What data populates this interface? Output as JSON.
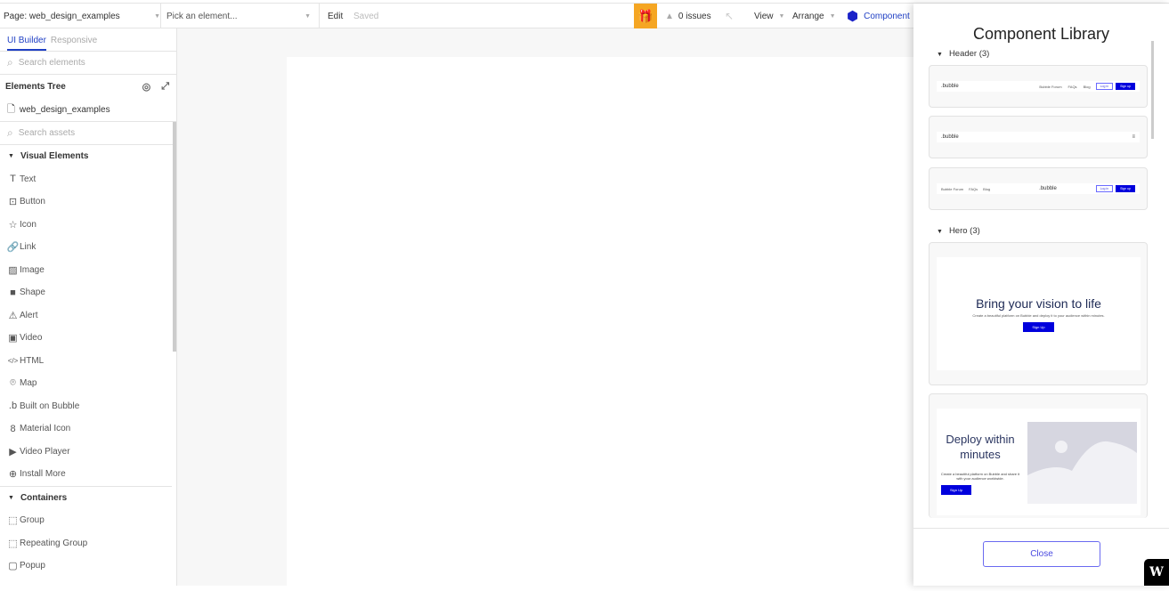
{
  "topbar": {
    "page_label": "Page: web_design_examples",
    "element_placeholder": "Pick an element...",
    "edit": "Edit",
    "saved": "Saved",
    "issues": "0 issues",
    "view": "View",
    "arrange": "Arrange",
    "components": "Component"
  },
  "left": {
    "tabs": [
      "UI Builder",
      "Responsive"
    ],
    "search_elements": "Search elements",
    "tree_title": "Elements Tree",
    "page_name": "web_design_examples",
    "search_assets": "Search assets",
    "visual_title": "Visual Elements",
    "visual": [
      {
        "label": "Text",
        "icon": "T"
      },
      {
        "label": "Button",
        "icon": "⊡"
      },
      {
        "label": "Icon",
        "icon": "☆"
      },
      {
        "label": "Link",
        "icon": "🔗"
      },
      {
        "label": "Image",
        "icon": "▨"
      },
      {
        "label": "Shape",
        "icon": "■"
      },
      {
        "label": "Alert",
        "icon": "⚠"
      },
      {
        "label": "Video",
        "icon": "▣"
      },
      {
        "label": "HTML",
        "icon": "</>"
      },
      {
        "label": "Map",
        "icon": "⌾"
      },
      {
        "label": "Built on Bubble",
        "icon": ".b"
      },
      {
        "label": "Material Icon",
        "icon": "8"
      },
      {
        "label": "Video Player",
        "icon": "▶"
      },
      {
        "label": "Install More",
        "icon": "⊕"
      }
    ],
    "containers_title": "Containers",
    "containers": [
      {
        "label": "Group",
        "icon": "⬚"
      },
      {
        "label": "Repeating Group",
        "icon": "⬚"
      },
      {
        "label": "Popup",
        "icon": "▢"
      }
    ]
  },
  "panel": {
    "title": "Component Library",
    "header_section": "Header (3)",
    "hero_section": "Hero (3)",
    "close": "Close",
    "header_preview": {
      "logo": ".bubble",
      "links": [
        "Bubble Forum",
        "FAQs",
        "Blog"
      ],
      "login": "Log in",
      "signup": "Sign up"
    },
    "hero1": {
      "title": "Bring your vision to life",
      "sub": "Create a beautiful platform on Bubble and deploy it to your audience within minutes.",
      "btn": "Sign Up"
    },
    "hero2": {
      "title": "Deploy within minutes",
      "sub": "Create a beautiful platform on Bubble and share it with your audience worldwide.",
      "btn": "Sign Up"
    }
  },
  "colors": {
    "accent": "#1f3fc4",
    "gift": "#f5a623",
    "brand_button": "#0000dd"
  }
}
